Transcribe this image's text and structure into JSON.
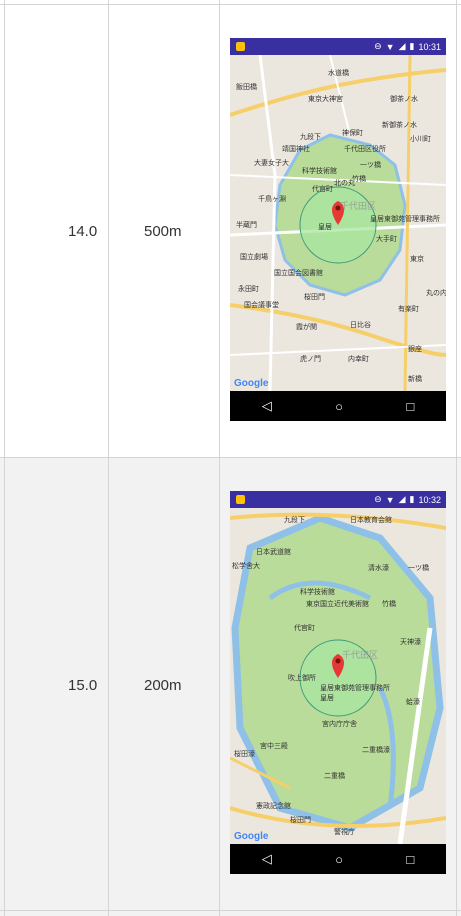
{
  "rows": [
    {
      "zoom": "14.0",
      "radius": "500m",
      "time": "10:31",
      "map_labels": [
        "飯田橋",
        "東京大神宮",
        "水道橋",
        "御茶ノ水",
        "九段下",
        "神保町",
        "新御茶ノ水",
        "小川町",
        "靖国神社",
        "千代田区役所",
        "大妻女子大",
        "科学技術館",
        "一ツ橋",
        "竹橋",
        "千鳥ヶ淵",
        "代官町",
        "北の丸",
        "皇居",
        "皇居東御苑管理事務所",
        "大手町",
        "半蔵門",
        "国立劇場",
        "永田町",
        "国会議事堂",
        "霞が関",
        "日比谷",
        "有楽町",
        "銀座",
        "内幸町",
        "虎ノ門",
        "新橋",
        "東京",
        "千代田区",
        "丸の内",
        "国立国会図書館",
        "桜田門"
      ],
      "brand": "Google"
    },
    {
      "zoom": "15.0",
      "radius": "200m",
      "time": "10:32",
      "map_labels": [
        "九段下",
        "日本教育会館",
        "日本武道館",
        "清水濠",
        "一ツ橋",
        "松学舎大",
        "科学技術館",
        "東京国立近代美術館",
        "竹橋",
        "代官町",
        "千代田区",
        "天神濠",
        "吹上御所",
        "皇居東御苑管理事務所",
        "皇居",
        "宮内庁庁舎",
        "蛤濠",
        "宮中三殿",
        "二重橋濠",
        "二重橋",
        "桜田濠",
        "憲政記念館",
        "桜田門",
        "警視庁"
      ],
      "brand": "Google"
    }
  ],
  "colors": {
    "status_bar": "#3a2fa0",
    "app_icon": "#ffc107",
    "circle_fill": "#a8e6a0",
    "circle_stroke": "#3a9a7a",
    "pin": "#e53935"
  },
  "icons": [
    "back-icon",
    "home-icon",
    "recents-icon",
    "battery-icon",
    "wifi-icon",
    "signal-icon",
    "dnd-icon",
    "map-pin-icon"
  ]
}
